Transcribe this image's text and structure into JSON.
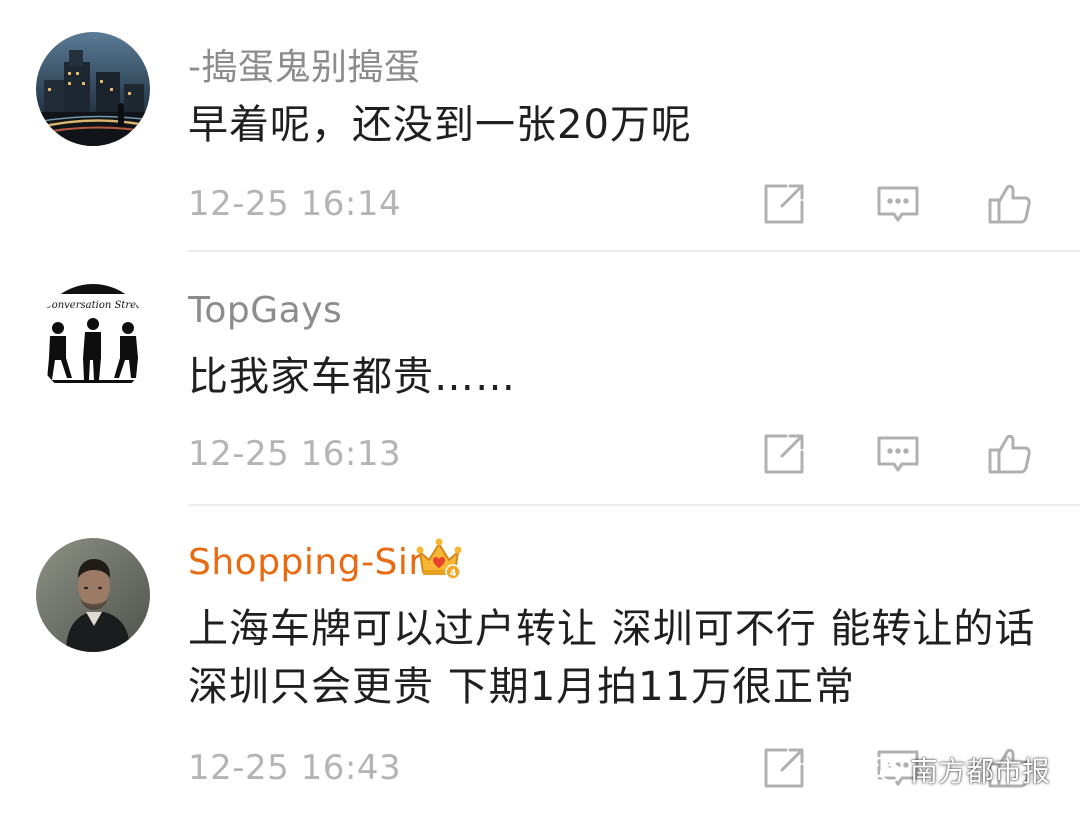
{
  "comments": [
    {
      "username": "-搗蛋鬼别搗蛋",
      "text": "早着呢，还没到一张20万呢",
      "timestamp": "12-25 16:14",
      "avatar_icon": "night-street-icon"
    },
    {
      "username": "TopGays",
      "text": "比我家车都贵……",
      "timestamp": "12-25 16:13",
      "avatar_icon": "conversation-street-icon",
      "avatar_caption": "Conversation Stree"
    },
    {
      "username": "Shopping-Sir",
      "text": "上海车牌可以过户转让 深圳可不行 能转让的话 深圳只会更贵 下期1月拍11万很正常",
      "timestamp": "12-25 16:43",
      "avatar_icon": "man-portrait-icon",
      "badge_icon": "crown-vip-icon",
      "badge_level": "4"
    }
  ],
  "actions": [
    "repost-icon",
    "comment-icon",
    "like-icon"
  ],
  "watermark": {
    "text": "南方都市报",
    "icon": "wechat-icon"
  },
  "colors": {
    "username": "#8c8c8c",
    "vip_username": "#e86b12",
    "text": "#1f1f1f",
    "timestamp": "#b4b4b4",
    "icon": "#b0b0b0"
  }
}
